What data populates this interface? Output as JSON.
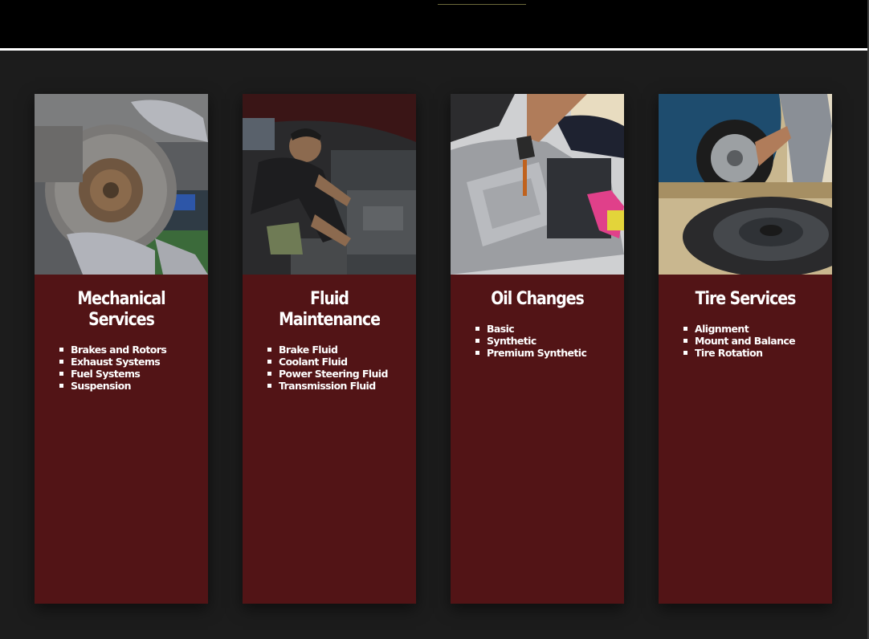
{
  "colors": {
    "page_background": "#1c1c1c",
    "header_background": "#000000",
    "card_background": "#521416",
    "text": "#ffffff"
  },
  "services": [
    {
      "title": "Mechanical Services",
      "photo": "brake-rotor-photo",
      "items": [
        "Brakes and Rotors",
        "Exhaust Systems",
        "Fuel Systems",
        "Suspension"
      ]
    },
    {
      "title": "Fluid Maintenance",
      "photo": "mechanic-engine-photo",
      "items": [
        "Brake Fluid",
        "Coolant Fluid",
        "Power Steering Fluid",
        "Transmission Fluid"
      ]
    },
    {
      "title": "Oil Changes",
      "photo": "oil-pour-photo",
      "items": [
        "Basic",
        "Synthetic",
        "Premium Synthetic"
      ]
    },
    {
      "title": "Tire Services",
      "photo": "tire-wheel-photo",
      "items": [
        "Alignment",
        "Mount and Balance",
        "Tire Rotation"
      ]
    }
  ]
}
